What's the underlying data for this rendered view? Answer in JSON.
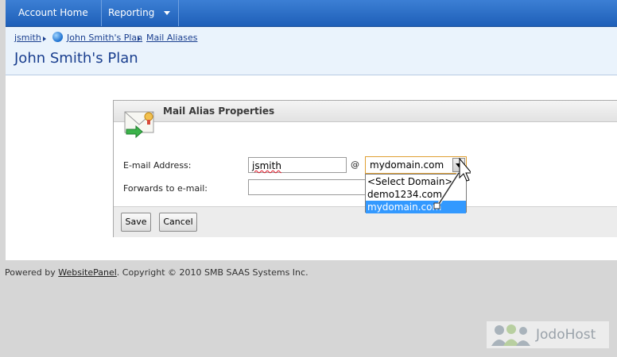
{
  "nav": {
    "items": [
      {
        "label": "Account Home"
      },
      {
        "label": "Reporting"
      }
    ]
  },
  "breadcrumb": {
    "items": [
      "jsmith",
      "John Smith's Plan",
      "Mail Aliases"
    ]
  },
  "page": {
    "title": "John Smith's Plan"
  },
  "panel": {
    "title": "Mail Alias Properties",
    "email_label": "E-mail Address:",
    "email_value": "jsmith",
    "at_sign": "@",
    "domain_selected": "mydomain.com",
    "domain_options": [
      "<Select Domain>",
      "demo1234.com",
      "mydomain.com"
    ],
    "forwards_label": "Forwards to e-mail:",
    "forwards_value": "",
    "save_label": "Save",
    "cancel_label": "Cancel"
  },
  "footer": {
    "prefix": "Powered by ",
    "link": "WebsitePanel",
    "suffix": ". Copyright © 2010 SMB SAAS Systems Inc."
  },
  "watermark": {
    "text": "JodoHost"
  },
  "colors": {
    "nav_blue": "#2a6cc7",
    "header_bg": "#eaf3fc",
    "title_blue": "#1a3f8f",
    "select_highlight": "#3399ff"
  }
}
